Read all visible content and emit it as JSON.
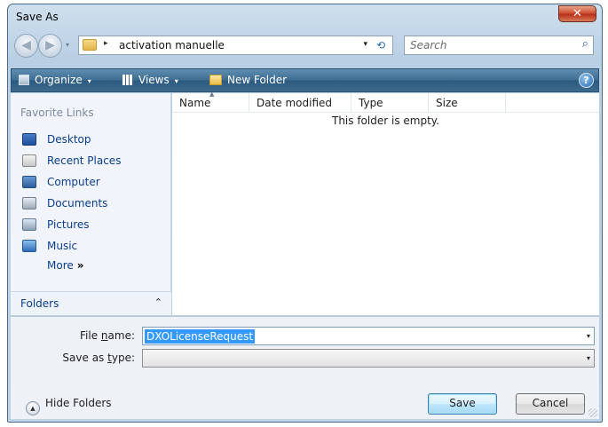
{
  "window": {
    "title": "Save As",
    "close_glyph": "✕"
  },
  "address_bar": {
    "folder_icon": "folder-icon",
    "breadcrumb_arrow": "▸",
    "path": "activation manuelle",
    "dropdown_glyph": "▾",
    "refresh_glyph": "⟲",
    "back_glyph": "◀",
    "forward_glyph": "▶",
    "nav_dropdown_glyph": "▾"
  },
  "search": {
    "placeholder": "Search",
    "icon_glyph": "⌕"
  },
  "toolbar": {
    "organize_label": "Organize",
    "views_label": "Views",
    "new_folder_label": "New Folder",
    "caret_glyph": "▾",
    "help_glyph": "?"
  },
  "navigation_pane": {
    "title": "Favorite Links",
    "links": [
      {
        "label": "Desktop",
        "icon": "desktop-icon"
      },
      {
        "label": "Recent Places",
        "icon": "recent-places-icon"
      },
      {
        "label": "Computer",
        "icon": "computer-icon"
      },
      {
        "label": "Documents",
        "icon": "documents-icon"
      },
      {
        "label": "Pictures",
        "icon": "pictures-icon"
      },
      {
        "label": "Music",
        "icon": "music-icon"
      }
    ],
    "more_label": "More",
    "more_glyph": "»",
    "folders_label": "Folders",
    "folders_toggle_glyph": "⌃"
  },
  "file_list": {
    "columns": [
      "Name",
      "Date modified",
      "Type",
      "Size"
    ],
    "sort_glyph": "▲",
    "empty_message": "This folder is empty."
  },
  "form": {
    "file_name_label_pre": "File ",
    "file_name_label_u": "n",
    "file_name_label_post": "ame:",
    "file_name_value": "DXOLicenseRequest",
    "save_type_label_pre": "Save as ",
    "save_type_label_u": "t",
    "save_type_label_post": "ype:",
    "save_type_value": "",
    "dropdown_glyph": "▾"
  },
  "footer": {
    "hide_folders_label": "Hide Folders",
    "hide_folders_glyph": "▲",
    "save_label": "Save",
    "cancel_label": "Cancel"
  },
  "colors": {
    "accent": "#3399ff",
    "link": "#0b3d8c",
    "command_bar": "#3f6d92",
    "close_button": "#cf5132"
  }
}
